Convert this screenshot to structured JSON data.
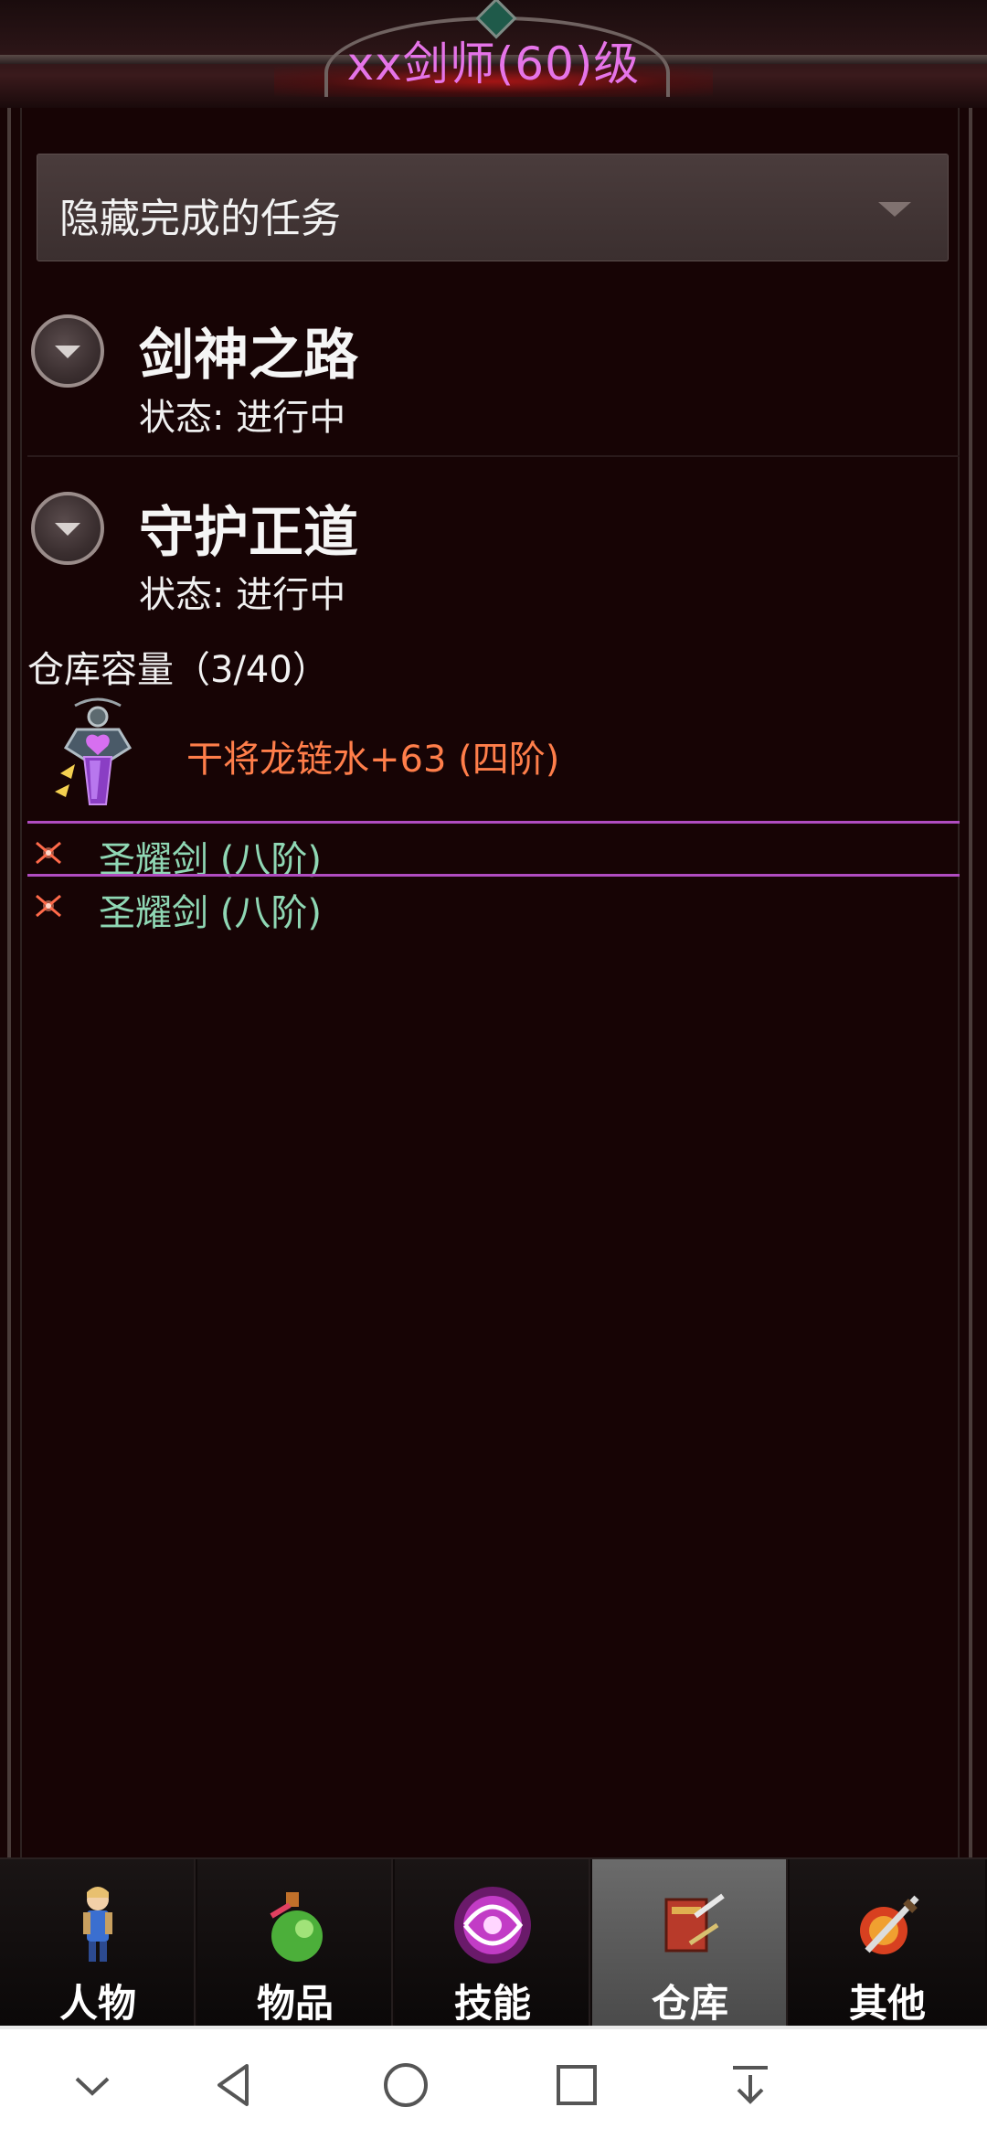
{
  "header": {
    "title": "xx剑师(60)级"
  },
  "filter": {
    "selected": "隐藏完成的任务"
  },
  "quests": [
    {
      "name": "剑神之路",
      "status_label": "状态:",
      "status_value": "进行中"
    },
    {
      "name": "守护正道",
      "status_label": "状态:",
      "status_value": "进行中"
    }
  ],
  "warehouse": {
    "label": "仓库容量",
    "count": "（3/40）",
    "items": [
      {
        "name": "干将龙链水+63 (四阶)",
        "icon": "amulet-icon",
        "color": "#ff7e4a"
      },
      {
        "name": "圣耀剑 (八阶)",
        "icon": "sword-spark-icon",
        "color": "#8fd7b4"
      },
      {
        "name": "圣耀剑 (八阶)",
        "icon": "sword-spark-icon",
        "color": "#8fd7b4"
      }
    ]
  },
  "tabs": [
    {
      "label": "人物",
      "icon": "character-icon",
      "active": false
    },
    {
      "label": "物品",
      "icon": "potion-icon",
      "active": false
    },
    {
      "label": "技能",
      "icon": "skill-orb-icon",
      "active": false
    },
    {
      "label": "仓库",
      "icon": "warehouse-chest-icon",
      "active": true
    },
    {
      "label": "其他",
      "icon": "sword-shield-icon",
      "active": false
    }
  ],
  "colors": {
    "title": "#e574e8",
    "separator": "#b04cc0",
    "background": "#170405"
  },
  "system_nav": [
    "chevron-down-icon",
    "back-triangle-icon",
    "home-circle-icon",
    "recents-square-icon",
    "notification-pull-icon"
  ]
}
